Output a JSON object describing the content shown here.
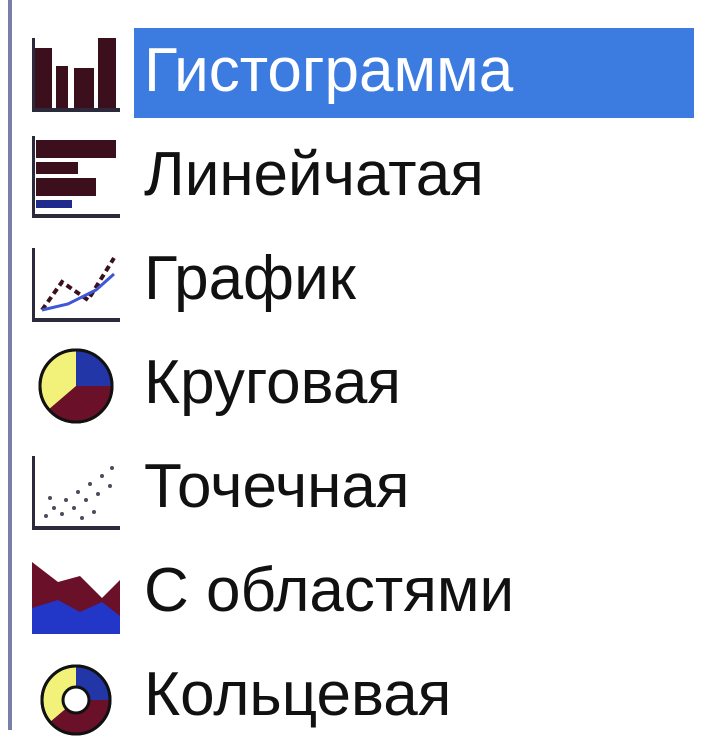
{
  "chart_type_list": {
    "selected_index": 0,
    "items": [
      {
        "label": "Гистограмма",
        "icon": "column-chart-icon"
      },
      {
        "label": "Линейчатая",
        "icon": "bar-chart-icon"
      },
      {
        "label": "График",
        "icon": "line-chart-icon"
      },
      {
        "label": "Круговая",
        "icon": "pie-chart-icon"
      },
      {
        "label": "Точечная",
        "icon": "scatter-chart-icon"
      },
      {
        "label": "С областями",
        "icon": "area-chart-icon"
      },
      {
        "label": "Кольцевая",
        "icon": "doughnut-chart-icon"
      }
    ],
    "selection_color": "#3c7be0"
  }
}
